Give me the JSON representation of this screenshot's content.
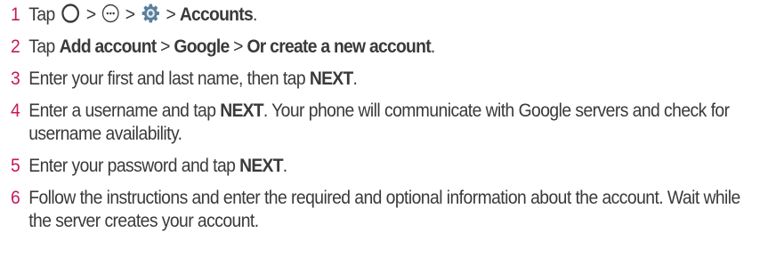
{
  "steps": [
    {
      "number": "1",
      "tap": "Tap",
      "sep1": ">",
      "sep2": ">",
      "sep3": ">",
      "accounts": "Accounts",
      "end": ".",
      "icons": [
        "home-circle-icon",
        "apps-icon",
        "settings-gear-icon"
      ]
    },
    {
      "number": "2",
      "tap": "Tap",
      "add_account": "Add account",
      "sep1": ">",
      "google": "Google",
      "sep2": ">",
      "create": "Or create a new account",
      "end": "."
    },
    {
      "number": "3",
      "text": "Enter your first and last name, then tap",
      "next": "NEXT",
      "end": "."
    },
    {
      "number": "4",
      "text1": "Enter a username and tap",
      "next": "NEXT",
      "text2": ". Your phone will communicate with Google servers and check for username availability."
    },
    {
      "number": "5",
      "text": "Enter your password and tap",
      "next": "NEXT",
      "end": "."
    },
    {
      "number": "6",
      "text": "Follow the instructions and enter the required and optional information about the account. Wait while the server creates your account."
    }
  ],
  "colors": {
    "step_number": "#c8175d",
    "text": "#3a3a3a"
  }
}
